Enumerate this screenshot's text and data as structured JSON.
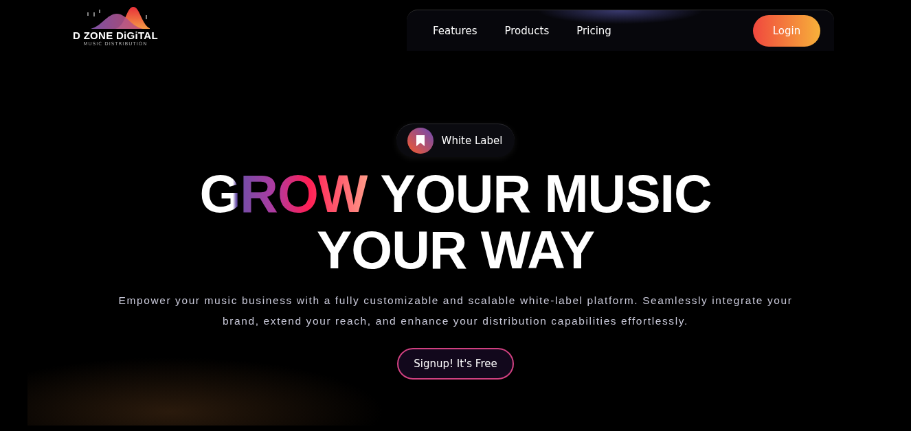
{
  "logo": {
    "name": "D ZONE DiGiTAL",
    "tagline": "MUSIC DISTRIBUTION"
  },
  "nav": {
    "links": [
      "Features",
      "Products",
      "Pricing"
    ],
    "login": "Login"
  },
  "hero": {
    "badge": "White Label",
    "headline_accent": "GROW",
    "headline_rest": "YOUR MUSIC YOUR WAY",
    "description": "Empower your music business with a fully customizable and scalable white-label platform. Seamlessly integrate your brand, extend your reach, and enhance your distribution capabilities effortlessly.",
    "cta": "Signup! It's Free"
  }
}
